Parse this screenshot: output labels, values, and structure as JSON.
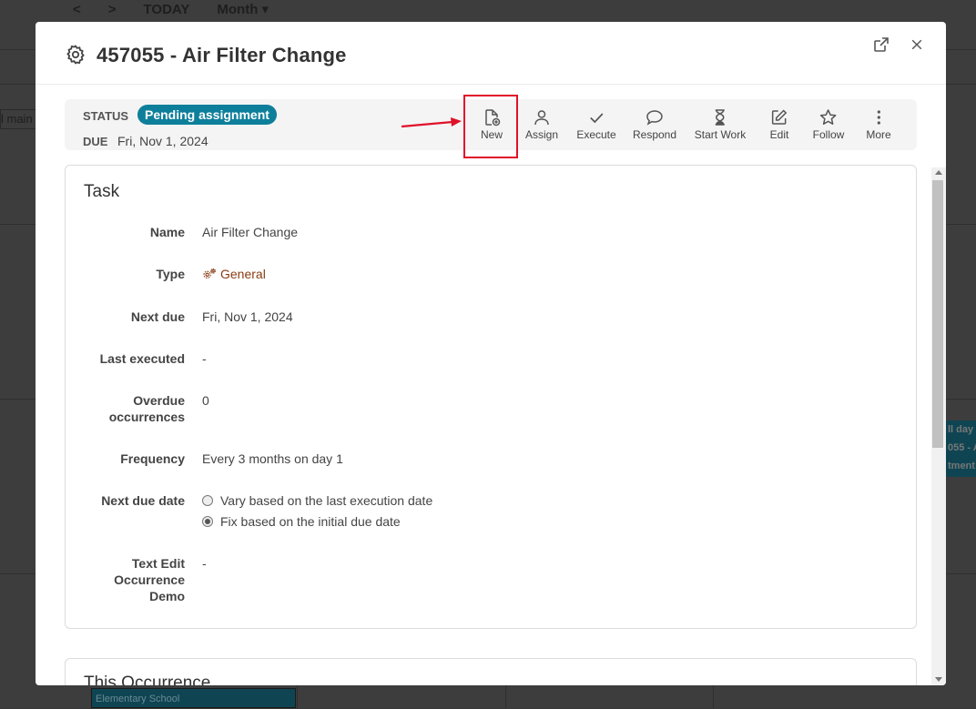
{
  "background": {
    "nav_prev": "<",
    "nav_next": ">",
    "today": "TODAY",
    "view": "Month ▾",
    "left_chip": "l main",
    "right_event_lines": [
      "ll day",
      "055 - A",
      "tment"
    ],
    "bottom_event": "Elementary School"
  },
  "modal": {
    "title": "457055 - Air Filter Change",
    "title_icon": "gear-icon",
    "open_external_icon": "external-link-icon",
    "close_icon": "close-icon"
  },
  "status": {
    "label": "STATUS",
    "badge": "Pending assignment",
    "badge_color": "#0e7f9b",
    "due_label": "DUE",
    "due_value": "Fri, Nov 1, 2024"
  },
  "actions": [
    {
      "label": "New",
      "icon": "new-document-icon"
    },
    {
      "label": "Assign",
      "icon": "person-icon"
    },
    {
      "label": "Execute",
      "icon": "checkmark-icon"
    },
    {
      "label": "Respond",
      "icon": "chat-bubble-icon"
    },
    {
      "label": "Start Work",
      "icon": "hourglass-icon"
    },
    {
      "label": "Edit",
      "icon": "pencil-icon"
    },
    {
      "label": "Follow",
      "icon": "star-icon"
    },
    {
      "label": "More",
      "icon": "more-vertical-icon"
    }
  ],
  "highlight_color": "#e0112a",
  "task": {
    "title": "Task",
    "fields": {
      "name_label": "Name",
      "name_value": "Air Filter Change",
      "type_label": "Type",
      "type_value": "General",
      "next_due_label": "Next due",
      "next_due_value": "Fri, Nov 1, 2024",
      "last_executed_label": "Last executed",
      "last_executed_value": "-",
      "overdue_label_1": "Overdue",
      "overdue_label_2": "occurrences",
      "overdue_value": "0",
      "frequency_label": "Frequency",
      "frequency_value": "Every 3 months on day 1",
      "next_due_date_label": "Next due date",
      "radio_vary": "Vary based on the last execution date",
      "radio_fix": "Fix based on the initial due date",
      "text_edit_label_1": "Text Edit",
      "text_edit_label_2": "Occurrence",
      "text_edit_label_3": "Demo",
      "text_edit_value": "-"
    }
  },
  "occurrence": {
    "title": "This Occurrence"
  }
}
